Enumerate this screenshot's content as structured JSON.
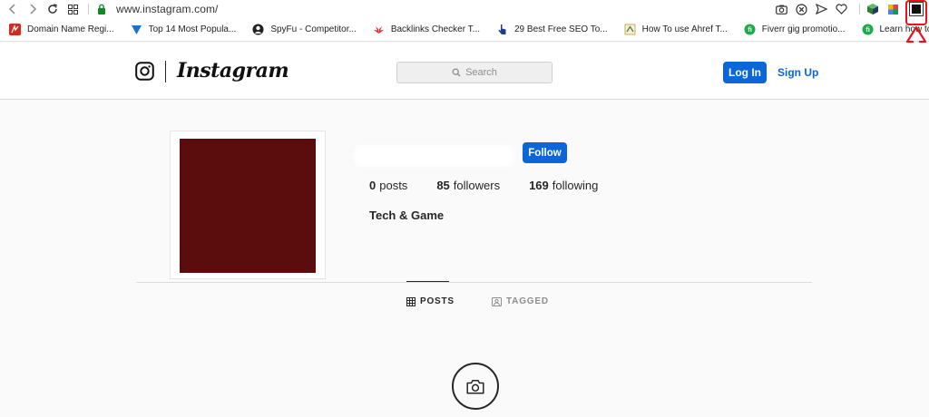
{
  "browser": {
    "url": "www.instagram.com/",
    "bookmarks": [
      {
        "label": "Domain Name Regi...",
        "icon": "namecheap-icon",
        "color": "#d6281f"
      },
      {
        "label": "Top 14 Most Popula...",
        "icon": "triangle-icon",
        "color": "#1a73c9"
      },
      {
        "label": "SpyFu - Competitor...",
        "icon": "spyfu-icon",
        "color": "#222222"
      },
      {
        "label": "Backlinks Checker T...",
        "icon": "huawei-icon",
        "color": "#e3262c"
      },
      {
        "label": "29 Best Free SEO To...",
        "icon": "cursor-hand-icon",
        "color": "#1d3f8a"
      },
      {
        "label": "How To use Ahref T...",
        "icon": "ahrefs-icon",
        "color": "#c79b2f"
      },
      {
        "label": "Fiverr gig promotio...",
        "icon": "fiverr-icon",
        "color": "#1dab4a"
      },
      {
        "label": "Learn how to Succe...",
        "icon": "fiverr-icon",
        "color": "#1dab4a"
      }
    ]
  },
  "instagram": {
    "wordmark": "Instagram",
    "search_placeholder": "Search",
    "login_label": "Log In",
    "signup_label": "Sign Up"
  },
  "profile": {
    "follow_label": "Follow",
    "posts_count": "0",
    "posts_label": "posts",
    "followers_count": "85",
    "followers_label": "followers",
    "following_count": "169",
    "following_label": "following",
    "bio": "Tech & Game",
    "picture_color": "#5b0d0d"
  },
  "tabs": {
    "posts": "POSTS",
    "tagged": "TAGGED"
  },
  "colors": {
    "accent_blue": "#0a66d9",
    "annotation_red": "#e8141c"
  }
}
